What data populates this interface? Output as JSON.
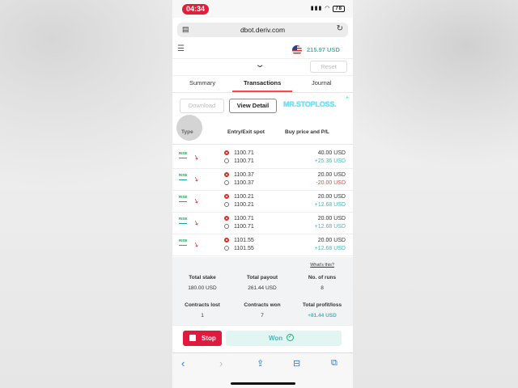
{
  "status": {
    "time": "04:34",
    "battery": "78"
  },
  "browser": {
    "url": "dbot.deriv.com"
  },
  "header": {
    "balance": "215.97 USD"
  },
  "controls": {
    "reset_label": "Reset"
  },
  "tabs": [
    {
      "label": "Summary",
      "active": false
    },
    {
      "label": "Transactions",
      "active": true
    },
    {
      "label": "Journal",
      "active": false
    }
  ],
  "actions": {
    "download_label": "Download",
    "view_detail_label": "View Detail"
  },
  "ad": {
    "text": "MR.STOPLOSS."
  },
  "columns": {
    "type": "Type",
    "spot": "Entry/Exit spot",
    "price_pl": "Buy price and P/L"
  },
  "transactions": [
    {
      "entry": "1100.71",
      "exit": "1100.71",
      "buy_price": "40.00 USD",
      "pl": "+25.36 USD",
      "positive": true
    },
    {
      "entry": "1100.37",
      "exit": "1100.37",
      "buy_price": "20.00 USD",
      "pl": "-20.00 USD",
      "positive": false
    },
    {
      "entry": "1100.21",
      "exit": "1100.21",
      "buy_price": "20.00 USD",
      "pl": "+12.68 USD",
      "positive": true
    },
    {
      "entry": "1100.71",
      "exit": "1100.71",
      "buy_price": "20.00 USD",
      "pl": "+12.68 USD",
      "positive": true
    },
    {
      "entry": "1101.55",
      "exit": "1101.55",
      "buy_price": "20.00 USD",
      "pl": "+12.68 USD",
      "positive": true
    }
  ],
  "summary": {
    "whats_this": "What's this?",
    "total_stake_label": "Total stake",
    "total_stake": "180.00 USD",
    "total_payout_label": "Total payout",
    "total_payout": "261.44 USD",
    "runs_label": "No. of runs",
    "runs": "8",
    "lost_label": "Contracts lost",
    "lost": "1",
    "won_label": "Contracts won",
    "won": "7",
    "profit_label": "Total profit/loss",
    "profit": "+81.44 USD"
  },
  "bot": {
    "stop_label": "Stop",
    "status_label": "Won"
  },
  "colors": {
    "accent_red": "#ff444f",
    "profit_green": "#4bb4b3",
    "loss_red": "#ec3f3f",
    "stop_red": "#e1193c"
  }
}
